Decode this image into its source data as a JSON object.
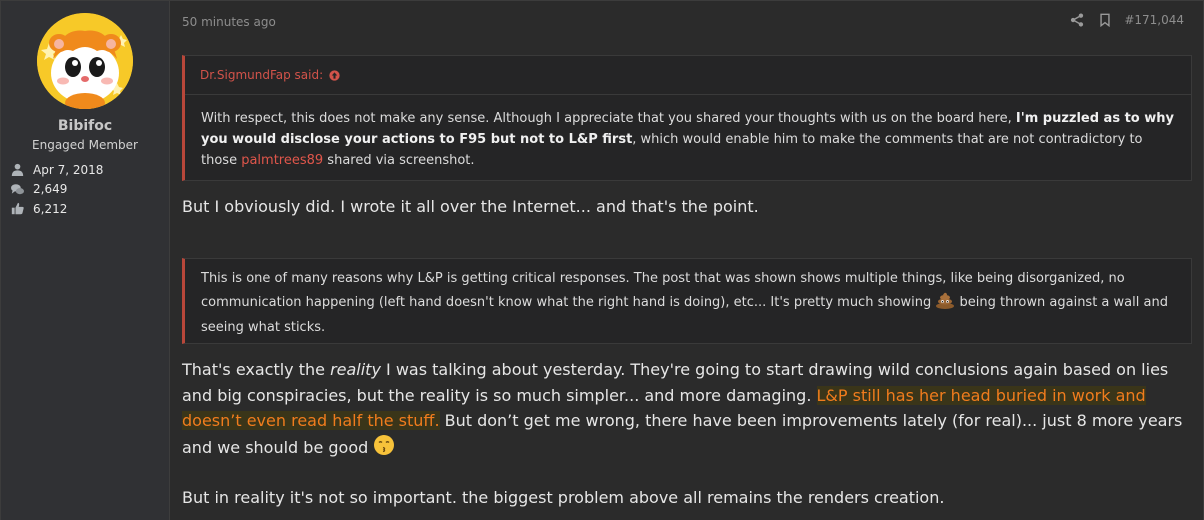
{
  "user": {
    "name": "Bibifoc",
    "title": "Engaged Member",
    "joined": "Apr 7, 2018",
    "messages": "2,649",
    "reactions": "6,212"
  },
  "post": {
    "time": "50 minutes ago",
    "number": "#171,044"
  },
  "quote1": {
    "author": "Dr.SigmundFap said:",
    "part1": "With respect, this does not make any sense. Although I appreciate that you shared your thoughts with us on the board here, ",
    "bold": "I'm puzzled as to why you would disclose your actions to F95 but not to L&P first",
    "part2": ", which would enable him to make the comments that are not contradictory to those ",
    "mention": "palmtrees89",
    "part3": " shared via screenshot."
  },
  "line1": "But I obviously did. I wrote it all over the Internet... and that's the point.",
  "quote2": {
    "part1": "This is one of many reasons why L&P is getting critical responses. The post that was shown shows multiple things, like being disorganized, no communication happening (left hand doesn't know what the right hand is doing), etc... It's pretty much showing ",
    "part2": " being thrown against a wall and seeing what sticks."
  },
  "para2": {
    "part1": "That's exactly the ",
    "italic": "reality",
    "part2": " I was talking about yesterday. They're going to start drawing wild conclusions again based on lies and big conspiracies, but the reality is so much simpler... and more damaging. ",
    "highlight": "L&P still has her head buried in work and doesn’t even read half the stuff.",
    "part3": " But don’t get me wrong, there have been improvements lately (for real)... just 8 more years and we should be good "
  },
  "para3": "But in reality it's not so important. the biggest problem above all remains the renders creation.",
  "icons": [
    "share-icon",
    "bookmark-icon",
    "user-icon",
    "comments-icon",
    "thumbs-up-icon",
    "arrow-up-circle-icon",
    "poop-emoji",
    "kissing-emoji"
  ],
  "colors": {
    "accent": "#e0564b",
    "highlight_text": "#f07c1d",
    "background": "#2b2b2b"
  }
}
